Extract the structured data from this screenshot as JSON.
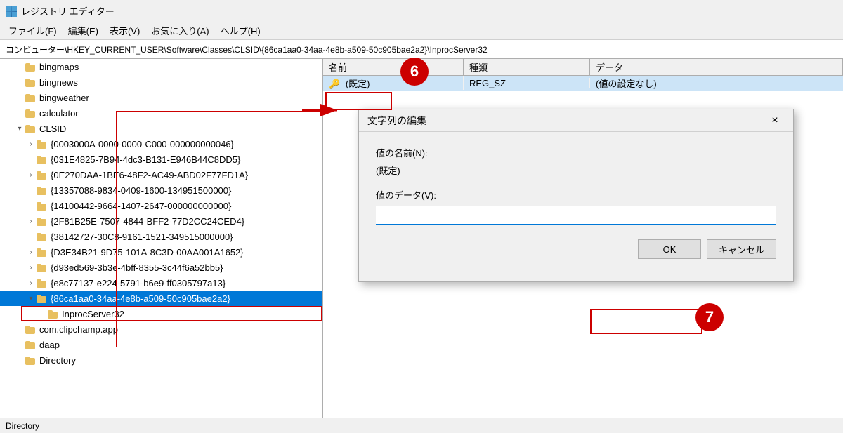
{
  "titleBar": {
    "title": "レジストリ エディター",
    "iconLabel": "registry-editor-icon"
  },
  "menuBar": {
    "items": [
      {
        "label": "ファイル(F)"
      },
      {
        "label": "編集(E)"
      },
      {
        "label": "表示(V)"
      },
      {
        "label": "お気に入り(A)"
      },
      {
        "label": "ヘルプ(H)"
      }
    ]
  },
  "addressBar": {
    "path": "コンピューター\\HKEY_CURRENT_USER\\Software\\Classes\\CLSID\\{86ca1aa0-34aa-4e8b-a509-50c905bae2a2}\\InprocServer32"
  },
  "treePane": {
    "items": [
      {
        "id": "bingmaps",
        "label": "bingmaps",
        "indent": 1,
        "hasArrow": false,
        "arrowDir": ""
      },
      {
        "id": "bingnews",
        "label": "bingnews",
        "indent": 1,
        "hasArrow": false,
        "arrowDir": ""
      },
      {
        "id": "bingweather",
        "label": "bingweather",
        "indent": 1,
        "hasArrow": false,
        "arrowDir": ""
      },
      {
        "id": "calculator",
        "label": "calculator",
        "indent": 1,
        "hasArrow": false,
        "arrowDir": ""
      },
      {
        "id": "clsid",
        "label": "CLSID",
        "indent": 1,
        "hasArrow": true,
        "arrowDir": "down",
        "expanded": true
      },
      {
        "id": "guid1",
        "label": "{0003000A-0000-0000-C000-000000000046}",
        "indent": 2,
        "hasArrow": true,
        "arrowDir": "right"
      },
      {
        "id": "guid2",
        "label": "{031E4825-7B94-4dc3-B131-E946B44C8DD5}",
        "indent": 2,
        "hasArrow": false,
        "arrowDir": ""
      },
      {
        "id": "guid3",
        "label": "{0E270DAA-1BE6-48F2-AC49-ABD02F77FD1A}",
        "indent": 2,
        "hasArrow": true,
        "arrowDir": "right"
      },
      {
        "id": "guid4",
        "label": "{13357088-9834-0409-1600-134951500000}",
        "indent": 2,
        "hasArrow": false,
        "arrowDir": ""
      },
      {
        "id": "guid5",
        "label": "{14100442-9664-1407-2647-000000000000}",
        "indent": 2,
        "hasArrow": false,
        "arrowDir": ""
      },
      {
        "id": "guid6",
        "label": "{2F81B25E-7507-4844-BFF2-77D2CC24CED4}",
        "indent": 2,
        "hasArrow": true,
        "arrowDir": "right"
      },
      {
        "id": "guid7",
        "label": "{38142727-30C8-9161-1521-349515000000}",
        "indent": 2,
        "hasArrow": false,
        "arrowDir": ""
      },
      {
        "id": "guid8",
        "label": "{D3E34B21-9D75-101A-8C3D-00AA001A1652}",
        "indent": 2,
        "hasArrow": true,
        "arrowDir": "right"
      },
      {
        "id": "guid9",
        "label": "{d93ed569-3b3e-4bff-8355-3c44f6a52bb5}",
        "indent": 2,
        "hasArrow": true,
        "arrowDir": "right"
      },
      {
        "id": "guid10",
        "label": "{e8c77137-e224-5791-b6e9-ff0305797a13}",
        "indent": 2,
        "hasArrow": true,
        "arrowDir": "right"
      },
      {
        "id": "guid11",
        "label": "{86ca1aa0-34aa-4e8b-a509-50c905bae2a2}",
        "indent": 2,
        "hasArrow": true,
        "arrowDir": "down",
        "expanded": true,
        "selected": true
      },
      {
        "id": "inproc",
        "label": "InprocServer32",
        "indent": 3,
        "hasArrow": false,
        "arrowDir": "",
        "highlighted": true
      },
      {
        "id": "comclipchamp",
        "label": "com.clipchamp.app",
        "indent": 1,
        "hasArrow": false,
        "arrowDir": ""
      },
      {
        "id": "daap",
        "label": "daap",
        "indent": 1,
        "hasArrow": false,
        "arrowDir": ""
      },
      {
        "id": "directory",
        "label": "Directory",
        "indent": 1,
        "hasArrow": false,
        "arrowDir": ""
      }
    ]
  },
  "detailPane": {
    "columns": [
      "名前",
      "種類",
      "データ"
    ],
    "rows": [
      {
        "name": "(既定)",
        "type": "REG_SZ",
        "data": "(値の設定なし)",
        "selected": true
      }
    ]
  },
  "dialog": {
    "title": "文字列の編集",
    "fieldNameLabel": "値の名前(N):",
    "fieldNameValue": "(既定)",
    "fieldDataLabel": "値のデータ(V):",
    "fieldDataValue": "",
    "okLabel": "OK",
    "cancelLabel": "キャンセル",
    "closeLabel": "×"
  },
  "annotations": {
    "circle6": "6",
    "circle7": "7"
  },
  "statusBar": {
    "text": "Directory"
  }
}
